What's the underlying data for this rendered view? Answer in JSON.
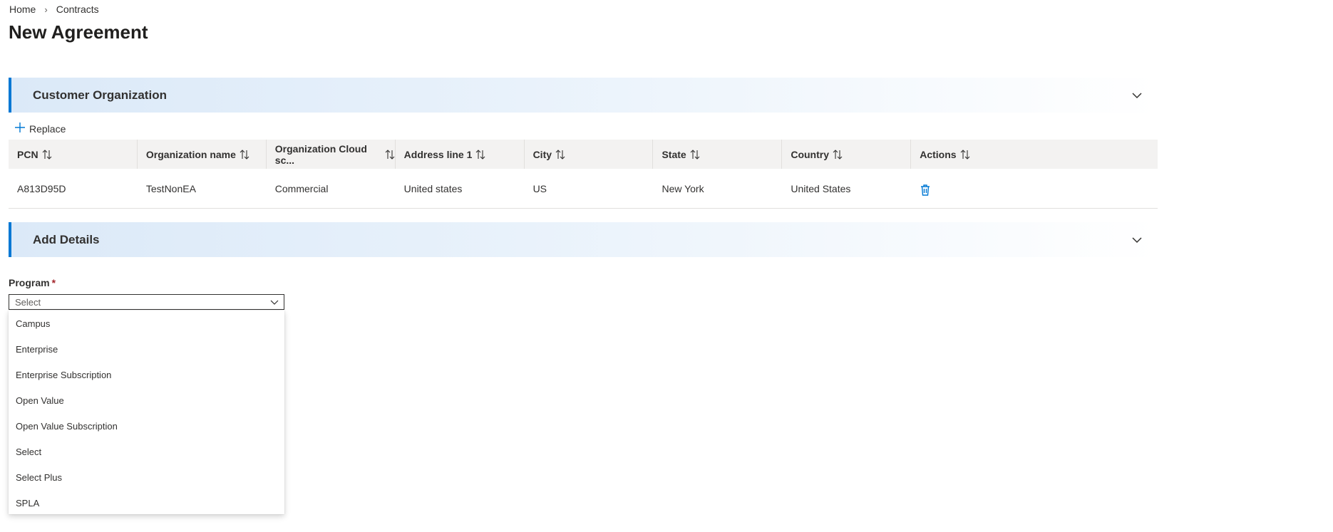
{
  "breadcrumb": {
    "items": [
      "Home",
      "Contracts"
    ],
    "separator": "›"
  },
  "page": {
    "title": "New Agreement"
  },
  "customer_section": {
    "title": "Customer Organization",
    "replace_label": "Replace",
    "columns": [
      "PCN",
      "Organization name",
      "Organization Cloud sc...",
      "Address line 1",
      "City",
      "State",
      "Country",
      "Actions"
    ],
    "rows": [
      {
        "pcn": "A813D95D",
        "org_name": "TestNonEA",
        "cloud": "Commercial",
        "address": "United states",
        "city": "US",
        "state": "New York",
        "country": "United States"
      }
    ]
  },
  "details_section": {
    "title": "Add Details"
  },
  "program_field": {
    "label": "Program",
    "required_marker": "*",
    "value": "Select",
    "options": [
      "Campus",
      "Enterprise",
      "Enterprise Subscription",
      "Open Value",
      "Open Value Subscription",
      "Select",
      "Select Plus",
      "SPLA"
    ]
  },
  "colors": {
    "accent": "#0078d4",
    "required": "#a4262c",
    "header_bg": "#f3f2f1"
  },
  "icons": {
    "chevron": "chevron-down-icon",
    "add": "add-icon",
    "sort": "sort-icon",
    "delete": "trash-icon"
  }
}
